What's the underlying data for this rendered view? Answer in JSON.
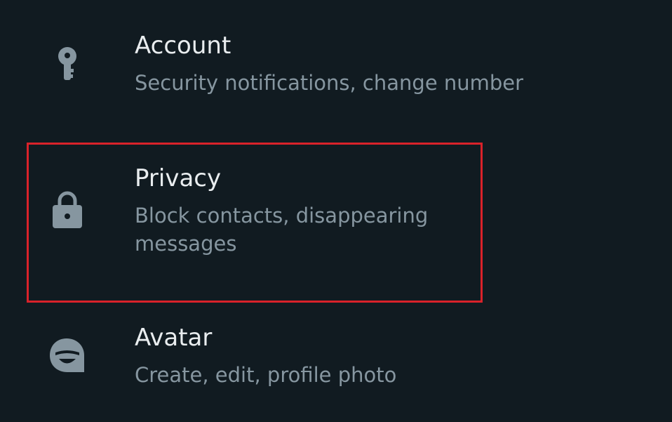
{
  "settings": {
    "items": [
      {
        "id": "account",
        "icon": "key-icon",
        "title": "Account",
        "subtitle": "Security notifications, change number"
      },
      {
        "id": "privacy",
        "icon": "lock-icon",
        "title": "Privacy",
        "subtitle": "Block contacts, disappearing messages",
        "highlighted": true
      },
      {
        "id": "avatar",
        "icon": "avatar-icon",
        "title": "Avatar",
        "subtitle": "Create, edit, profile photo"
      }
    ]
  },
  "colors": {
    "background": "#111b21",
    "title_text": "#e9edef",
    "subtitle_text": "#8696a0",
    "icon": "#8696a0",
    "highlight_border": "#d9222a"
  }
}
